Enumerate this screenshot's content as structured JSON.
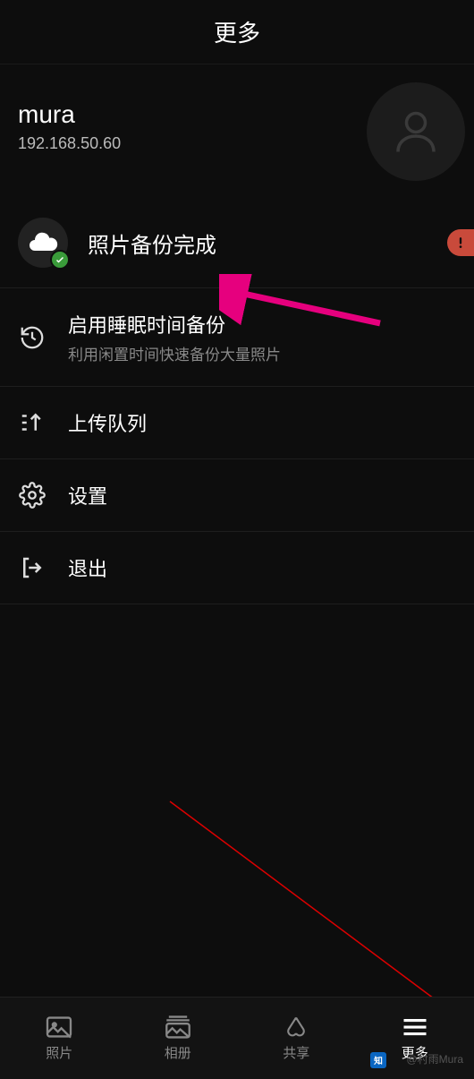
{
  "header": {
    "title": "更多"
  },
  "profile": {
    "name": "mura",
    "ip": "192.168.50.60"
  },
  "backup": {
    "status": "照片备份完成"
  },
  "menu": {
    "sleep": {
      "title": "启用睡眠时间备份",
      "sub": "利用闲置时间快速备份大量照片"
    },
    "queue": {
      "title": "上传队列"
    },
    "settings": {
      "title": "设置"
    },
    "logout": {
      "title": "退出"
    }
  },
  "nav": {
    "photos": "照片",
    "albums": "相册",
    "share": "共享",
    "more": "更多"
  },
  "watermark": "@村雨Mura"
}
